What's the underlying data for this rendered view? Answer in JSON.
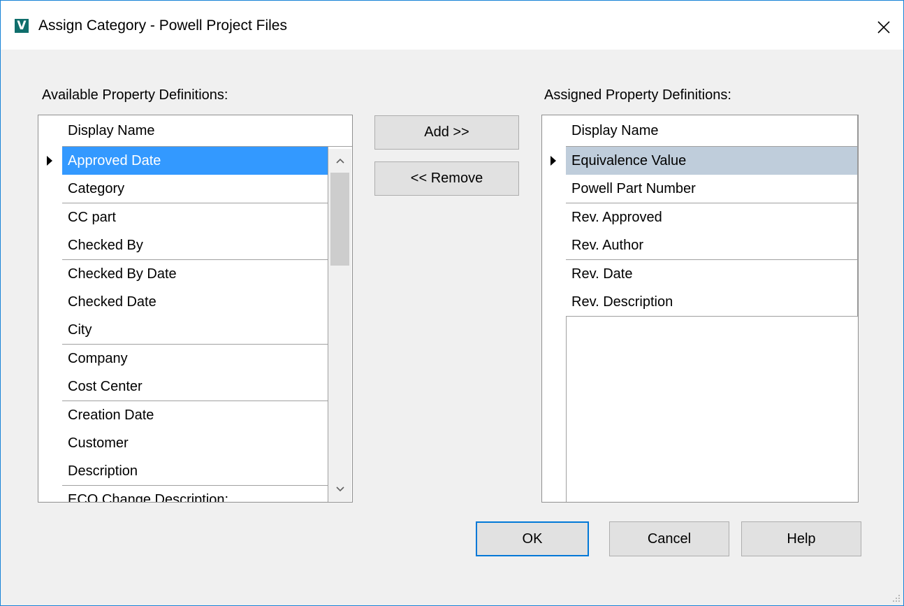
{
  "window": {
    "title": "Assign Category - Powell Project Files",
    "app_icon_letter": "V",
    "accent_color": "#1883d7"
  },
  "available": {
    "label": "Available Property Definitions:",
    "column_header": "Display Name",
    "selected_index": 0,
    "items": [
      "Approved Date",
      "Category",
      "CC part",
      "Checked By",
      "Checked By Date",
      "Checked Date",
      "City",
      "Company",
      "Cost Center",
      "Creation Date",
      "Customer",
      "Description",
      "ECO Change Description:"
    ]
  },
  "assigned": {
    "label": "Assigned Property Definitions:",
    "column_header": "Display Name",
    "selected_index": 0,
    "items": [
      "Equivalence Value",
      "Powell Part Number",
      "Rev. Approved",
      "Rev. Author",
      "Rev. Date",
      "Rev. Description"
    ]
  },
  "buttons": {
    "add": "Add >>",
    "remove": "<< Remove",
    "ok": "OK",
    "cancel": "Cancel",
    "help": "Help"
  },
  "colors": {
    "selection_active": "#3399ff",
    "selection_inactive": "#bfcddb",
    "default_button_border": "#0078d7"
  }
}
